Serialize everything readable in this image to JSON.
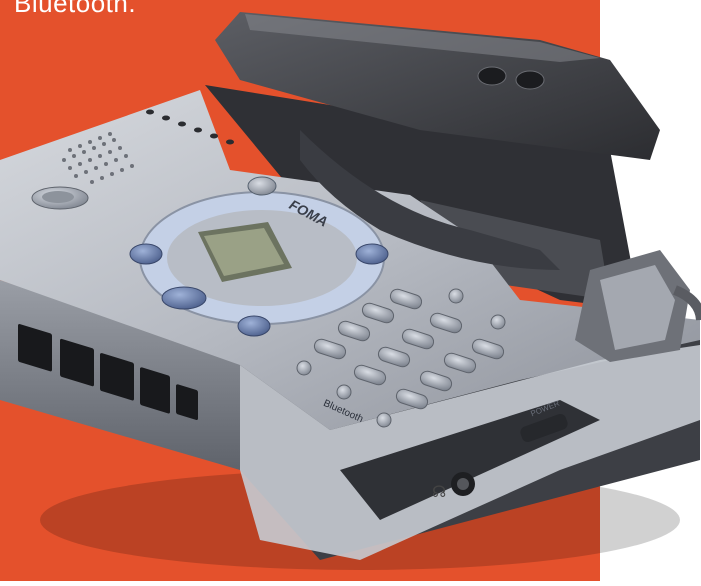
{
  "caption": "Bluetooth.",
  "device": {
    "brand_label": "FOMA",
    "bluetooth_label": "Bluetooth",
    "power_label": "POWER"
  },
  "colors": {
    "background_panel": "#e4512c",
    "device_body": "#b8bcc4",
    "device_dark": "#3e4046",
    "lcd": "#9aa186"
  }
}
